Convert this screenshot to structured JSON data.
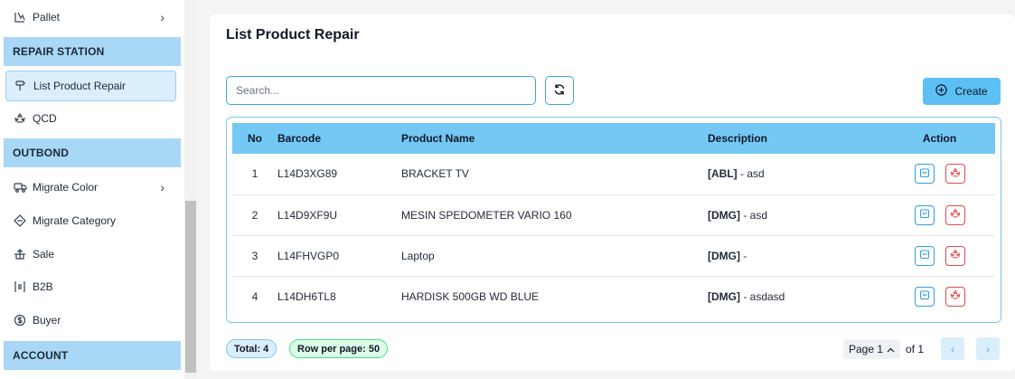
{
  "sidebar": {
    "items": [
      {
        "label": "Pallet"
      },
      {
        "label": "List Product Repair"
      },
      {
        "label": "QCD"
      },
      {
        "label": "Migrate Color"
      },
      {
        "label": "Migrate Category"
      },
      {
        "label": "Sale"
      },
      {
        "label": "B2B"
      },
      {
        "label": "Buyer"
      }
    ],
    "sections": {
      "repair_station": "REPAIR STATION",
      "outbond": "OUTBOND",
      "account": "ACCOUNT"
    }
  },
  "main": {
    "title": "List Product Repair",
    "search": {
      "placeholder": "Search...",
      "value": ""
    },
    "create_label": "Create",
    "table": {
      "headers": [
        "No",
        "Barcode",
        "Product Name",
        "Description",
        "Action"
      ],
      "rows": [
        {
          "no": "1",
          "barcode": "L14D3XG89",
          "product": "BRACKET TV",
          "desc_tag": "[ABL]",
          "desc_text": " - asd"
        },
        {
          "no": "2",
          "barcode": "L14D9XF9U",
          "product": "MESIN SPEDOMETER VARIO 160",
          "desc_tag": "[DMG]",
          "desc_text": " - asd"
        },
        {
          "no": "3",
          "barcode": "L14FHVGP0",
          "product": "Laptop",
          "desc_tag": "[DMG]",
          "desc_text": " -"
        },
        {
          "no": "4",
          "barcode": "L14DH6TL8",
          "product": "HARDISK 500GB WD BLUE",
          "desc_tag": "[DMG]",
          "desc_text": " - asdasd"
        }
      ]
    },
    "footer": {
      "total": "Total: 4",
      "rows_per_page": "Row per page: 50",
      "page_label": "Page 1",
      "of_label": "of 1"
    }
  },
  "colors": {
    "section_bg": "#a8d8f5",
    "table_header_bg": "#74c8f4",
    "create_btn_bg": "#5cc0f4",
    "action_blue": "#2e9fe0",
    "action_red": "#e24a4a"
  }
}
